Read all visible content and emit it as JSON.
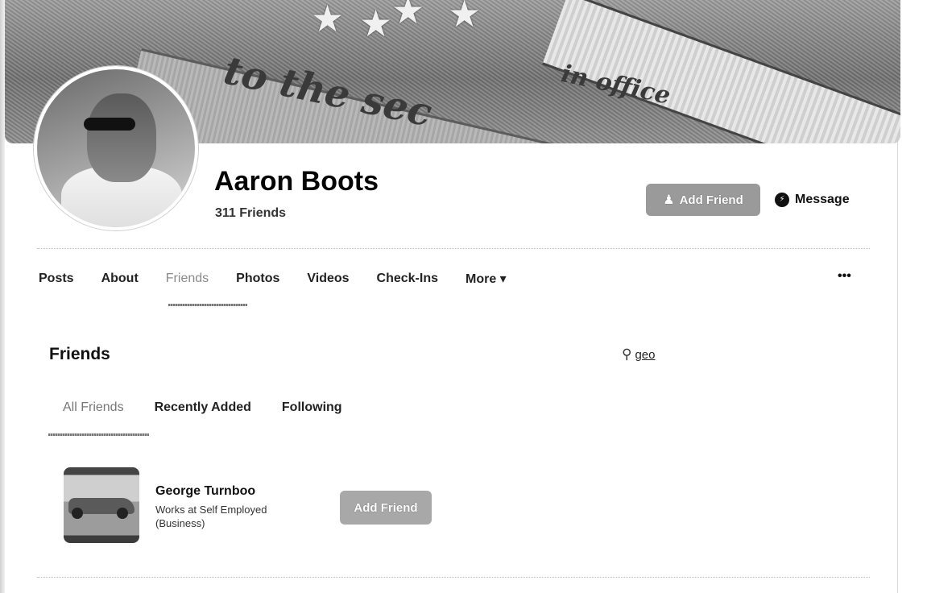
{
  "profile": {
    "name": "Aaron Boots",
    "friends_count": "311 Friends",
    "add_friend_label": "Add Friend",
    "message_label": "Message"
  },
  "cover": {
    "text_1": "to the sec",
    "text_2": "in office"
  },
  "tabs": {
    "items": [
      {
        "label": "Posts"
      },
      {
        "label": "About"
      },
      {
        "label": "Friends",
        "active": true
      },
      {
        "label": "Photos"
      },
      {
        "label": "Videos"
      },
      {
        "label": "Check-Ins"
      },
      {
        "label": "More ▾"
      }
    ],
    "overflow_label": "•••"
  },
  "friends_section": {
    "title": "Friends",
    "search_value": "geo",
    "search_icon": "search-icon",
    "subtabs": [
      {
        "label": "All Friends",
        "active": true
      },
      {
        "label": "Recently Added"
      },
      {
        "label": "Following"
      }
    ],
    "results": [
      {
        "name": "George Turnboo",
        "work_line_1": "Works at Self Employed",
        "work_line_2": "(Business)",
        "add_friend_label": "Add Friend"
      }
    ]
  },
  "colors": {
    "button_gray": "#9a9a9a",
    "text_dark": "#111111"
  }
}
